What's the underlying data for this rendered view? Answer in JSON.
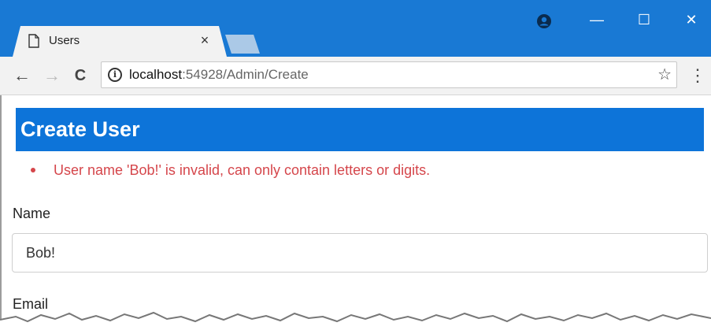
{
  "browser": {
    "tab": {
      "title": "Users",
      "close": "×"
    },
    "window": {
      "minimize": "—",
      "maximize": "☐",
      "close": "✕"
    },
    "toolbar": {
      "url_host": "localhost",
      "url_path": ":54928/Admin/Create",
      "back": "←",
      "forward": "→",
      "reload": "C",
      "bookmark": "☆",
      "menu": "⋮"
    }
  },
  "page": {
    "title": "Create User",
    "errors": [
      "User name 'Bob!' is invalid, can only contain letters or digits."
    ],
    "fields": {
      "name": {
        "label": "Name",
        "value": "Bob!"
      },
      "email": {
        "label": "Email"
      }
    }
  },
  "colors": {
    "titlebar": "#1979d4",
    "heading_bg": "#0d74d9",
    "error": "#d5464b"
  },
  "icons": [
    "page-icon",
    "close-icon",
    "new-tab-icon",
    "profile-icon",
    "minimize-icon",
    "maximize-icon",
    "window-close-icon",
    "back-icon",
    "forward-icon",
    "reload-icon",
    "info-icon",
    "star-icon",
    "menu-icon"
  ]
}
